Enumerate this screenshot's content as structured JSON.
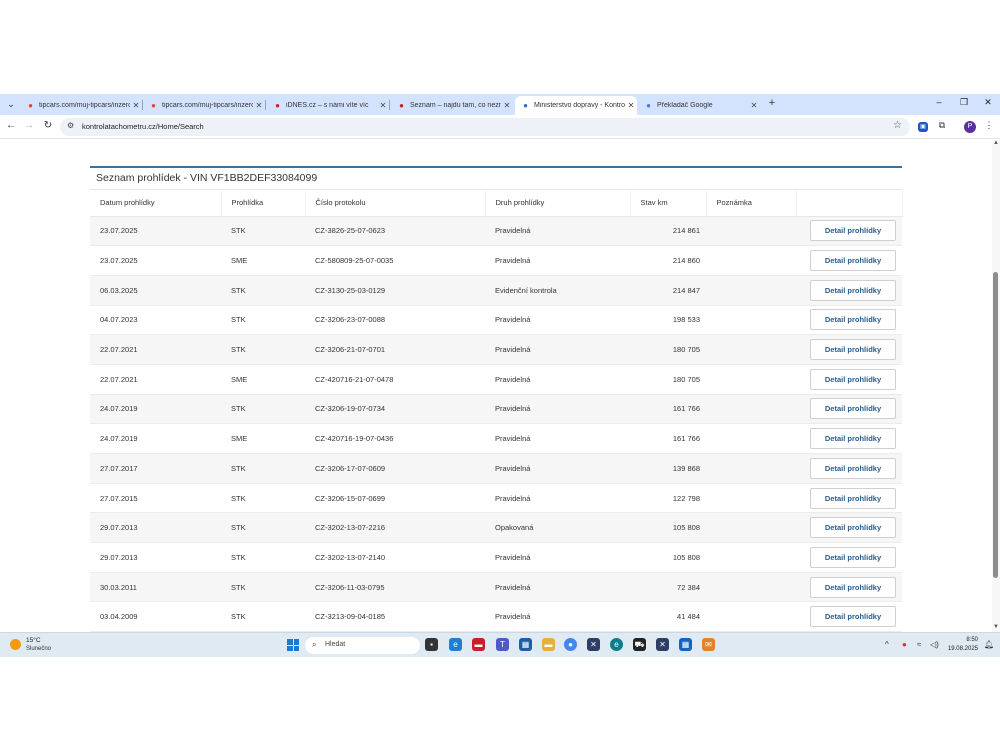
{
  "tabs": [
    {
      "title": "tipcars.com/muj-tipcars/inzerce",
      "favicon": "tipcars-icon",
      "color": "#e6452b"
    },
    {
      "title": "tipcars.com/muj-tipcars/inzerce",
      "favicon": "tipcars-icon",
      "color": "#e6452b"
    },
    {
      "title": "iDNES.cz – s námi víte víc",
      "favicon": "idnes-icon",
      "color": "#d31f26"
    },
    {
      "title": "Seznam – najdu tam, co neznám",
      "favicon": "seznam-icon",
      "color": "#cc1d1d"
    },
    {
      "title": "Ministerstvo dopravy - Kontrola",
      "favicon": "ministry-icon",
      "color": "#2a6ebb"
    },
    {
      "title": "Překladač Google",
      "favicon": "translate-icon",
      "color": "#4a7be8"
    }
  ],
  "active_tab_index": 4,
  "url": "kontrolatachometru.cz/Home/Search",
  "profile_initial": "P",
  "panel": {
    "title": "Seznam prohlídek - VIN VF1BB2DEF33084099",
    "columns": [
      "Datum prohlídky",
      "Prohlídka",
      "Číslo protokolu",
      "Druh prohlídky",
      "Stav km",
      "Poznámka"
    ],
    "button_label": "Detail prohlídky",
    "rows": [
      {
        "date": "23.07.2025",
        "type": "STK",
        "protocol": "CZ-3826-25-07-0623",
        "kind": "Pravidelná",
        "km": "214 861",
        "note": ""
      },
      {
        "date": "23.07.2025",
        "type": "SME",
        "protocol": "CZ-580809-25-07-0035",
        "kind": "Pravidelná",
        "km": "214 860",
        "note": ""
      },
      {
        "date": "06.03.2025",
        "type": "STK",
        "protocol": "CZ-3130-25-03-0129",
        "kind": "Evidenční kontrola",
        "km": "214 847",
        "note": ""
      },
      {
        "date": "04.07.2023",
        "type": "STK",
        "protocol": "CZ-3206-23-07-0088",
        "kind": "Pravidelná",
        "km": "198 533",
        "note": ""
      },
      {
        "date": "22.07.2021",
        "type": "STK",
        "protocol": "CZ-3206-21-07-0701",
        "kind": "Pravidelná",
        "km": "180 705",
        "note": ""
      },
      {
        "date": "22.07.2021",
        "type": "SME",
        "protocol": "CZ-420716-21-07-0478",
        "kind": "Pravidelná",
        "km": "180 705",
        "note": ""
      },
      {
        "date": "24.07.2019",
        "type": "STK",
        "protocol": "CZ-3206-19-07-0734",
        "kind": "Pravidelná",
        "km": "161 766",
        "note": ""
      },
      {
        "date": "24.07.2019",
        "type": "SME",
        "protocol": "CZ-420716-19-07-0436",
        "kind": "Pravidelná",
        "km": "161 766",
        "note": ""
      },
      {
        "date": "27.07.2017",
        "type": "STK",
        "protocol": "CZ-3206-17-07-0609",
        "kind": "Pravidelná",
        "km": "139 868",
        "note": ""
      },
      {
        "date": "27.07.2015",
        "type": "STK",
        "protocol": "CZ-3206-15-07-0699",
        "kind": "Pravidelná",
        "km": "122 798",
        "note": ""
      },
      {
        "date": "29.07.2013",
        "type": "STK",
        "protocol": "CZ-3202-13-07-2216",
        "kind": "Opakovaná",
        "km": "105 808",
        "note": ""
      },
      {
        "date": "29.07.2013",
        "type": "STK",
        "protocol": "CZ-3202-13-07-2140",
        "kind": "Pravidelná",
        "km": "105 808",
        "note": ""
      },
      {
        "date": "30.03.2011",
        "type": "STK",
        "protocol": "CZ-3206-11-03-0795",
        "kind": "Pravidelná",
        "km": "72 384",
        "note": ""
      },
      {
        "date": "03.04.2009",
        "type": "STK",
        "protocol": "CZ-3213-09-04-0185",
        "kind": "Pravidelná",
        "km": "41 484",
        "note": ""
      }
    ]
  },
  "taskbar": {
    "temperature": "15°C",
    "condition": "Slunečno",
    "search_placeholder": "Hledat",
    "time": "8:50",
    "date": "19.08.2025"
  },
  "colors": {
    "tab_strip": "#d3e3fd",
    "panel_accent": "#3d6e9d",
    "button_text": "#2a5d8c",
    "taskbar": "#dfeaf3"
  }
}
